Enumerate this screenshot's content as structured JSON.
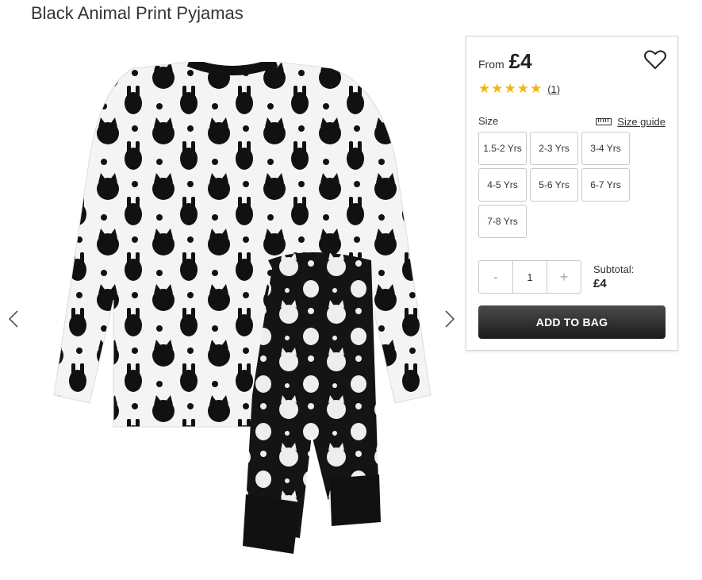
{
  "product": {
    "title": "Black Animal Print Pyjamas"
  },
  "gallery": {
    "prev_icon": "chevron-left-icon",
    "next_icon": "chevron-right-icon",
    "image_alt": "pyjamas-product-image"
  },
  "purchase": {
    "from_label": "From",
    "price": "£4",
    "wishlist_icon": "heart-icon",
    "stars": "★★★★★",
    "rating_value": 5,
    "reviews": "(1)",
    "size_label": "Size",
    "size_guide_label": "Size guide",
    "sizes": [
      "1.5-2 Yrs",
      "2-3 Yrs",
      "3-4 Yrs",
      "4-5 Yrs",
      "5-6 Yrs",
      "6-7 Yrs",
      "7-8 Yrs"
    ],
    "qty_minus": "-",
    "qty_plus": "+",
    "quantity": "1",
    "subtotal_label": "Subtotal:",
    "subtotal_value": "£4",
    "add_to_bag": "ADD TO BAG",
    "colors": {
      "star": "#f3b60f",
      "button": "#222222"
    }
  }
}
